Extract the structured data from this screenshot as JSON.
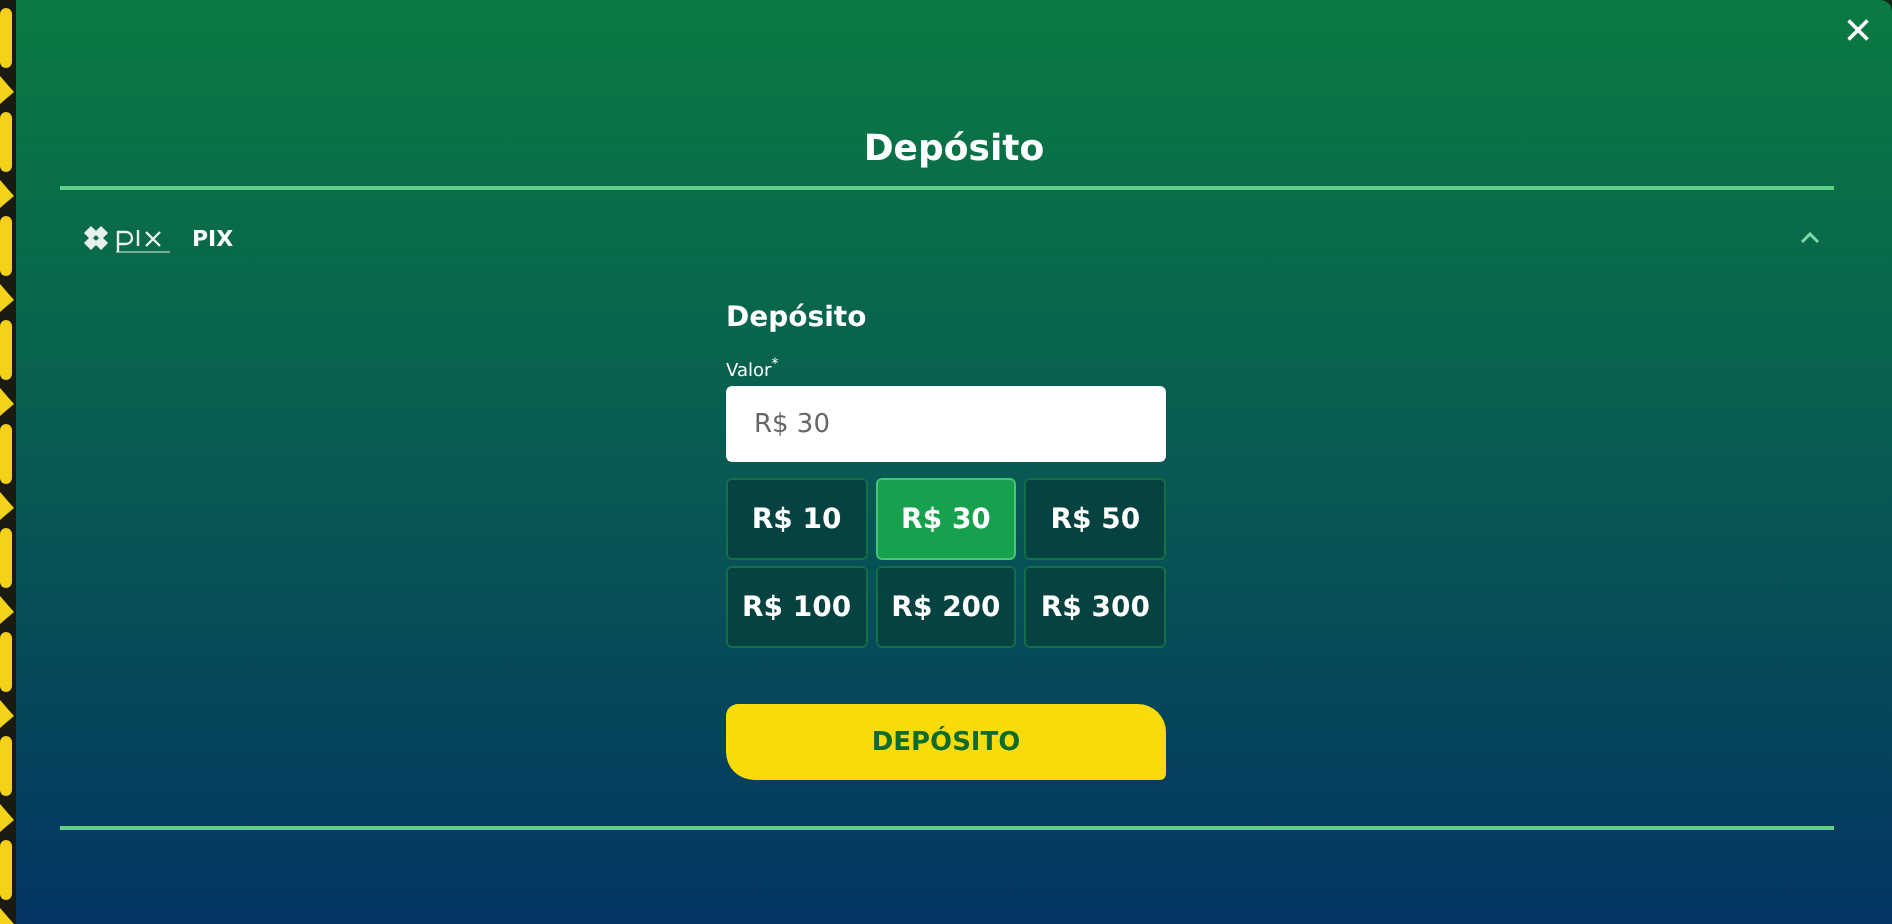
{
  "modal": {
    "title": "Depósito",
    "close": "×"
  },
  "method": {
    "name": "PIX",
    "expanded": true
  },
  "form": {
    "heading": "Depósito",
    "field_label": "Valor",
    "required_mark": "*",
    "value": "R$ 30",
    "amounts": [
      {
        "label": "R$ 10",
        "selected": false
      },
      {
        "label": "R$ 30",
        "selected": true
      },
      {
        "label": "R$ 50",
        "selected": false
      },
      {
        "label": "R$ 100",
        "selected": false
      },
      {
        "label": "R$ 200",
        "selected": false
      },
      {
        "label": "R$ 300",
        "selected": false
      }
    ],
    "submit": "DEPÓSITO"
  }
}
